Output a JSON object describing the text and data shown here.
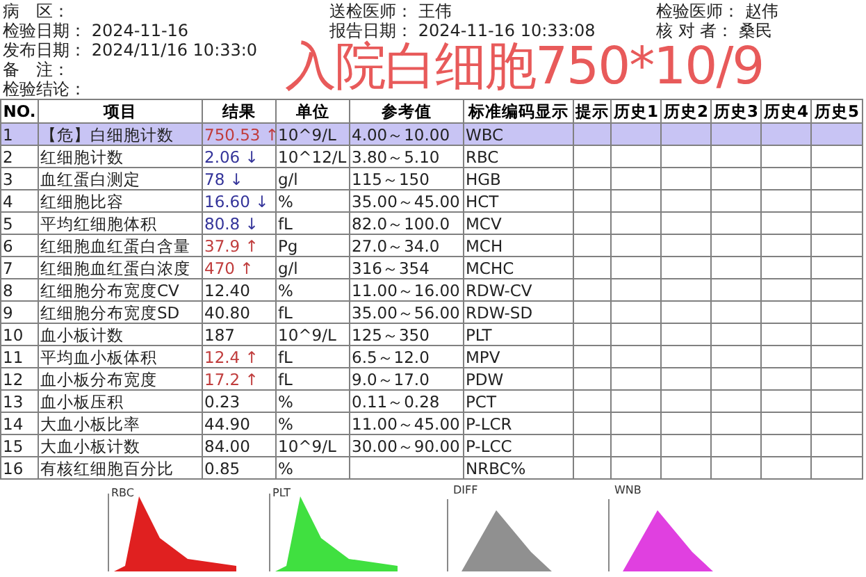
{
  "header": [
    {
      "cells": [
        {
          "label": "病　区："
        },
        {
          "label": "送检医师：",
          "value": "王伟"
        },
        {
          "label": "检验医师：",
          "value": "赵伟"
        }
      ]
    },
    {
      "cells": [
        {
          "label": "检验日期：",
          "value": "2024-11-16"
        },
        {
          "label": "报告日期：",
          "value": "2024-11-16 10:33:08"
        },
        {
          "label": "核 对 者：",
          "value": "桑民"
        }
      ]
    },
    {
      "cells": [
        {
          "label": "发布日期：",
          "value": "2024/11/16 10:33:0"
        }
      ]
    },
    {
      "cells": [
        {
          "label": "备　注："
        }
      ]
    },
    {
      "cells": [
        {
          "label": "检验结论："
        }
      ]
    }
  ],
  "annotation": "入院白细胞750*10/9",
  "table": {
    "columns": [
      "NO.",
      "项目",
      "结果",
      "单位",
      "参考值",
      "标准编码显示",
      "提示",
      "历史1",
      "历史2",
      "历史3",
      "历史4",
      "历史5"
    ],
    "rows": [
      {
        "no": "1",
        "item": "【危】白细胞计数",
        "result": "750.53 ↑",
        "color": "#c03c3c",
        "unit": "10^9/L",
        "range": "4.00～10.00",
        "code": "WBC",
        "selected": true
      },
      {
        "no": "2",
        "item": "红细胞计数",
        "result": "2.06 ↓",
        "color": "#34349a",
        "unit": "10^12/L",
        "range": "3.80～5.10",
        "code": "RBC",
        "selected": false
      },
      {
        "no": "3",
        "item": "血红蛋白测定",
        "result": "78 ↓",
        "color": "#34349a",
        "unit": "g/l",
        "range": "115～150",
        "code": "HGB",
        "selected": false
      },
      {
        "no": "4",
        "item": "红细胞比容",
        "result": "16.60 ↓",
        "color": "#34349a",
        "unit": "%",
        "range": "35.00～45.00",
        "code": "HCT",
        "selected": false
      },
      {
        "no": "5",
        "item": "平均红细胞体积",
        "result": "80.8 ↓",
        "color": "#34349a",
        "unit": "fL",
        "range": "82.0～100.0",
        "code": "MCV",
        "selected": false
      },
      {
        "no": "6",
        "item": "红细胞血红蛋白含量",
        "result": "37.9 ↑",
        "color": "#c03c3c",
        "unit": "Pg",
        "range": "27.0～34.0",
        "code": "MCH",
        "selected": false
      },
      {
        "no": "7",
        "item": "红细胞血红蛋白浓度",
        "result": "470 ↑",
        "color": "#c03c3c",
        "unit": "g/l",
        "range": "316～354",
        "code": "MCHC",
        "selected": false
      },
      {
        "no": "8",
        "item": "红细胞分布宽度CV",
        "result": "12.40",
        "color": "#222222",
        "unit": "%",
        "range": "11.00～16.00",
        "code": "RDW-CV",
        "selected": false
      },
      {
        "no": "9",
        "item": "红细胞分布宽度SD",
        "result": "40.80",
        "color": "#222222",
        "unit": "fL",
        "range": "35.00～56.00",
        "code": "RDW-SD",
        "selected": false
      },
      {
        "no": "10",
        "item": "血小板计数",
        "result": "187",
        "color": "#222222",
        "unit": "10^9/L",
        "range": "125～350",
        "code": "PLT",
        "selected": false
      },
      {
        "no": "11",
        "item": "平均血小板体积",
        "result": "12.4 ↑",
        "color": "#c03c3c",
        "unit": "fL",
        "range": "6.5～12.0",
        "code": "MPV",
        "selected": false
      },
      {
        "no": "12",
        "item": "血小板分布宽度",
        "result": "17.2 ↑",
        "color": "#c03c3c",
        "unit": "fL",
        "range": "9.0～17.0",
        "code": "PDW",
        "selected": false
      },
      {
        "no": "13",
        "item": "血小板压积",
        "result": "0.23",
        "color": "#222222",
        "unit": "%",
        "range": "0.11～0.28",
        "code": "PCT",
        "selected": false
      },
      {
        "no": "14",
        "item": "大血小板比率",
        "result": "44.90",
        "color": "#222222",
        "unit": "%",
        "range": "11.00～45.00",
        "code": "P-LCR",
        "selected": false
      },
      {
        "no": "15",
        "item": "大血小板计数",
        "result": "84.00",
        "color": "#222222",
        "unit": "10^9/L",
        "range": "30.00～90.00",
        "code": "P-LCC",
        "selected": false
      },
      {
        "no": "16",
        "item": "有核红细胞百分比",
        "result": "0.85",
        "color": "#222222",
        "unit": "%",
        "code": "NRBC%",
        "selected": false
      }
    ]
  },
  "graphs": [
    {
      "kind": "histogram",
      "label": "RBC",
      "color": "#e02020"
    },
    {
      "kind": "histogram",
      "label": "PLT",
      "color": "#40e040"
    },
    {
      "kind": "scatter",
      "label": "DIFF",
      "color": "#909090"
    },
    {
      "kind": "scatter",
      "label": "WNB",
      "color": "#e040e0"
    }
  ]
}
